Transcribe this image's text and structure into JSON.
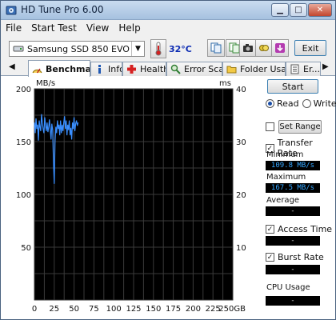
{
  "window": {
    "title": "HD Tune Pro 6.00"
  },
  "menu": {
    "items": [
      "File",
      "Start Test",
      "View",
      "Help"
    ]
  },
  "toolbar": {
    "drive": "Samsung SSD 850 EVO",
    "temperature": "32°C",
    "exit_label": "Exit",
    "icons": [
      "copy-info-icon",
      "copy-text-icon",
      "camera-icon",
      "save-icon",
      "download-icon"
    ]
  },
  "tabs": [
    {
      "label": "Benchmark",
      "active": true,
      "icon": "benchmark-icon"
    },
    {
      "label": "Info",
      "active": false,
      "icon": "info-icon"
    },
    {
      "label": "Health",
      "active": false,
      "icon": "health-icon"
    },
    {
      "label": "Error Scan",
      "active": false,
      "icon": "magnifier-icon"
    },
    {
      "label": "Folder Usage",
      "active": false,
      "icon": "folder-icon"
    },
    {
      "label": "Er...",
      "active": false,
      "icon": "erase-icon"
    }
  ],
  "chart_data": {
    "type": "line",
    "left_axis": {
      "unit": "MB/s",
      "ticks": [
        200,
        150,
        100,
        50
      ],
      "ylim": [
        0,
        200
      ]
    },
    "right_axis": {
      "unit": "ms",
      "ticks": [
        40,
        30,
        20,
        10
      ],
      "ylim": [
        0,
        40
      ]
    },
    "x_axis": {
      "ticks": [
        "0",
        "25",
        "50",
        "75",
        "100",
        "125",
        "150",
        "175",
        "200",
        "225",
        "250GB"
      ],
      "xlim": [
        0,
        250
      ]
    },
    "grid": true,
    "background": "#000000",
    "line_color": "#3a8fff",
    "series": [
      {
        "x": [
          0,
          1,
          2,
          3,
          4,
          5,
          6,
          7,
          8,
          9,
          10,
          11,
          12,
          13,
          14,
          15,
          16,
          17,
          18,
          19,
          20,
          21,
          22,
          23,
          24,
          25,
          26,
          27,
          28,
          29,
          30,
          31,
          32,
          33,
          34,
          35,
          36,
          37,
          38,
          39,
          40,
          41,
          42,
          43,
          44,
          45,
          46,
          47,
          48,
          49,
          50,
          51,
          52,
          53,
          54,
          55
        ],
        "y": [
          168,
          158,
          172,
          162,
          166,
          151,
          170,
          164,
          160,
          176,
          168,
          162,
          158,
          173,
          165,
          160,
          168,
          159,
          164,
          171,
          162,
          152,
          167,
          161,
          132,
          110,
          150,
          164,
          158,
          170,
          162,
          166,
          156,
          170,
          158,
          166,
          160,
          168,
          174,
          162,
          170,
          156,
          166,
          161,
          170,
          156,
          163,
          152,
          168,
          162,
          173,
          160,
          167,
          170,
          165,
          168
        ]
      }
    ]
  },
  "panel": {
    "start_label": "Start",
    "read_label": "Read",
    "write_label": "Write",
    "set_range_label": "Set Range",
    "transfer_rate_label": "Transfer Rate",
    "minimum_label": "Minimum",
    "minimum_value": "109.8 MB/s",
    "maximum_label": "Maximum",
    "maximum_value": "167.5 MB/s",
    "average_label": "Average",
    "average_value": "-",
    "access_time_label": "Access Time",
    "access_time_value": "-",
    "burst_rate_label": "Burst Rate",
    "burst_rate_value": "-",
    "cpu_usage_label": "CPU Usage",
    "cpu_usage_value": "-"
  }
}
